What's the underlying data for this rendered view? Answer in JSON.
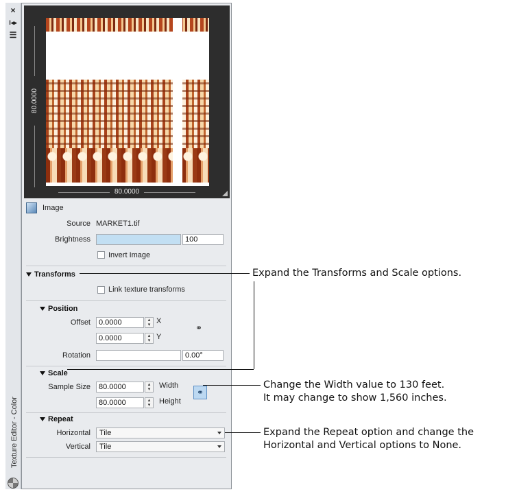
{
  "strip": {
    "close_glyph": "×",
    "pin_glyph": "I◂▸",
    "props_glyph": "☰",
    "title": "Texture Editor - Color"
  },
  "preview": {
    "height_dim": "80.0000",
    "width_dim": "80.0000"
  },
  "image": {
    "heading": "Image",
    "source_label": "Source",
    "source_value": "MARKET1.tif",
    "brightness_label": "Brightness",
    "brightness_value": "100",
    "brightness_fill": 1.0,
    "invert_label": "Invert Image"
  },
  "transforms": {
    "heading": "Transforms",
    "link_label": "Link texture transforms"
  },
  "position": {
    "heading": "Position",
    "offset_label": "Offset",
    "offset_x": "0.0000",
    "offset_y": "0.0000",
    "x_label": "X",
    "y_label": "Y",
    "rotation_label": "Rotation",
    "rotation_value": "0.00°"
  },
  "scale": {
    "heading": "Scale",
    "sample_label": "Sample Size",
    "width_value": "80.0000",
    "height_value": "80.0000",
    "width_label": "Width",
    "height_label": "Height"
  },
  "repeat": {
    "heading": "Repeat",
    "horizontal_label": "Horizontal",
    "horizontal_value": "Tile",
    "vertical_label": "Vertical",
    "vertical_value": "Tile"
  },
  "callouts": {
    "transforms": "Expand the Transforms and Scale options.",
    "width_line1": "Change the Width value to 130 feet.",
    "width_line2": "It may change to show 1,560 inches.",
    "repeat_line1": "Expand the Repeat option and change the",
    "repeat_line2": "Horizontal and Vertical options to None."
  }
}
